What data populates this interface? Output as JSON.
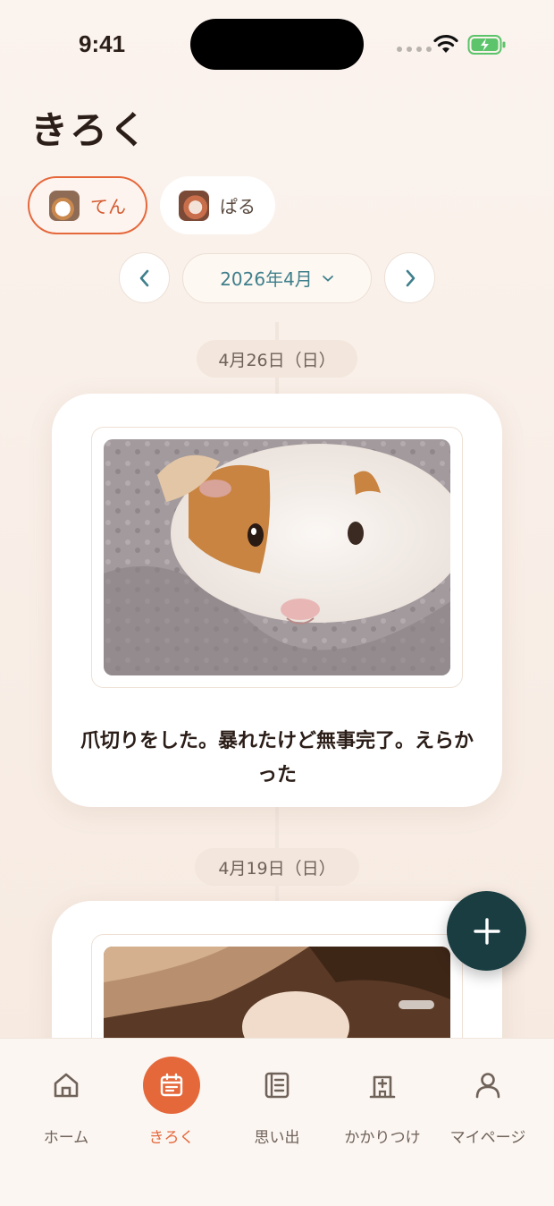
{
  "status_bar": {
    "time": "9:41"
  },
  "header": {
    "title": "きろく"
  },
  "pets": [
    {
      "name": "てん",
      "active": true,
      "avatar_icon": "guinea-pig-photo-icon"
    },
    {
      "name": "ぱる",
      "active": false,
      "avatar_icon": "guinea-pig-photo-icon"
    }
  ],
  "month_selector": {
    "label": "2026年4月",
    "prev_icon": "chevron-left-icon",
    "next_icon": "chevron-right-icon"
  },
  "entries": [
    {
      "date": "4月26日（日）",
      "caption": "爪切りをした。暴れたけど無事完了。えらかった"
    },
    {
      "date": "4月19日（日）",
      "caption": ""
    }
  ],
  "fab": {
    "icon": "plus-icon"
  },
  "tabbar": {
    "items": [
      {
        "label": "ホーム",
        "icon": "home-icon",
        "active": false
      },
      {
        "label": "きろく",
        "icon": "calendar-icon",
        "active": true
      },
      {
        "label": "思い出",
        "icon": "album-icon",
        "active": false
      },
      {
        "label": "かかりつけ",
        "icon": "hospital-icon",
        "active": false
      },
      {
        "label": "マイページ",
        "icon": "user-icon",
        "active": false
      }
    ]
  },
  "colors": {
    "accent": "#e5683b",
    "teal": "#3f7f8c",
    "fab": "#193d41",
    "background": "#f8ece3"
  }
}
